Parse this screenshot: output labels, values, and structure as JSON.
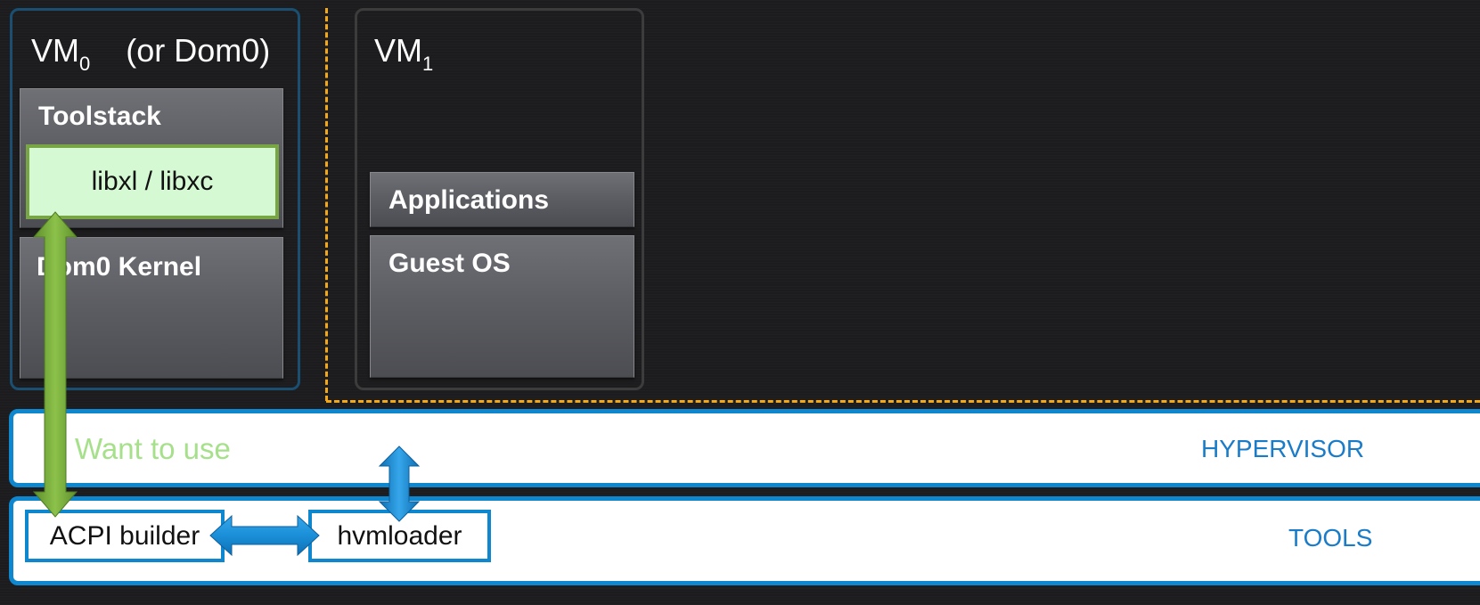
{
  "vm0": {
    "title": "VM",
    "subscript": "0",
    "title_suffix": "(or Dom0)",
    "toolstack_label": "Toolstack",
    "lib_label": "libxl / libxc",
    "kernel_label": "Dom0 Kernel"
  },
  "vm1": {
    "title": "VM",
    "subscript": "1",
    "applications_label": "Applications",
    "guest_os_label": "Guest OS"
  },
  "hypervisor": {
    "label": "HYPERVISOR",
    "note": "Want to use"
  },
  "tools": {
    "label": "TOOLS",
    "acpi_builder": "ACPI builder",
    "hvmloader": "hvmloader"
  },
  "colors": {
    "background": "#1c1c1e",
    "dashed_separator": "#f2a818",
    "band_border": "#0f87cf",
    "green_arrow": "#7cb13f",
    "blue_arrow": "#1a8fd8",
    "lib_fill": "#d5f9d3",
    "want_text": "#a6e08b"
  }
}
